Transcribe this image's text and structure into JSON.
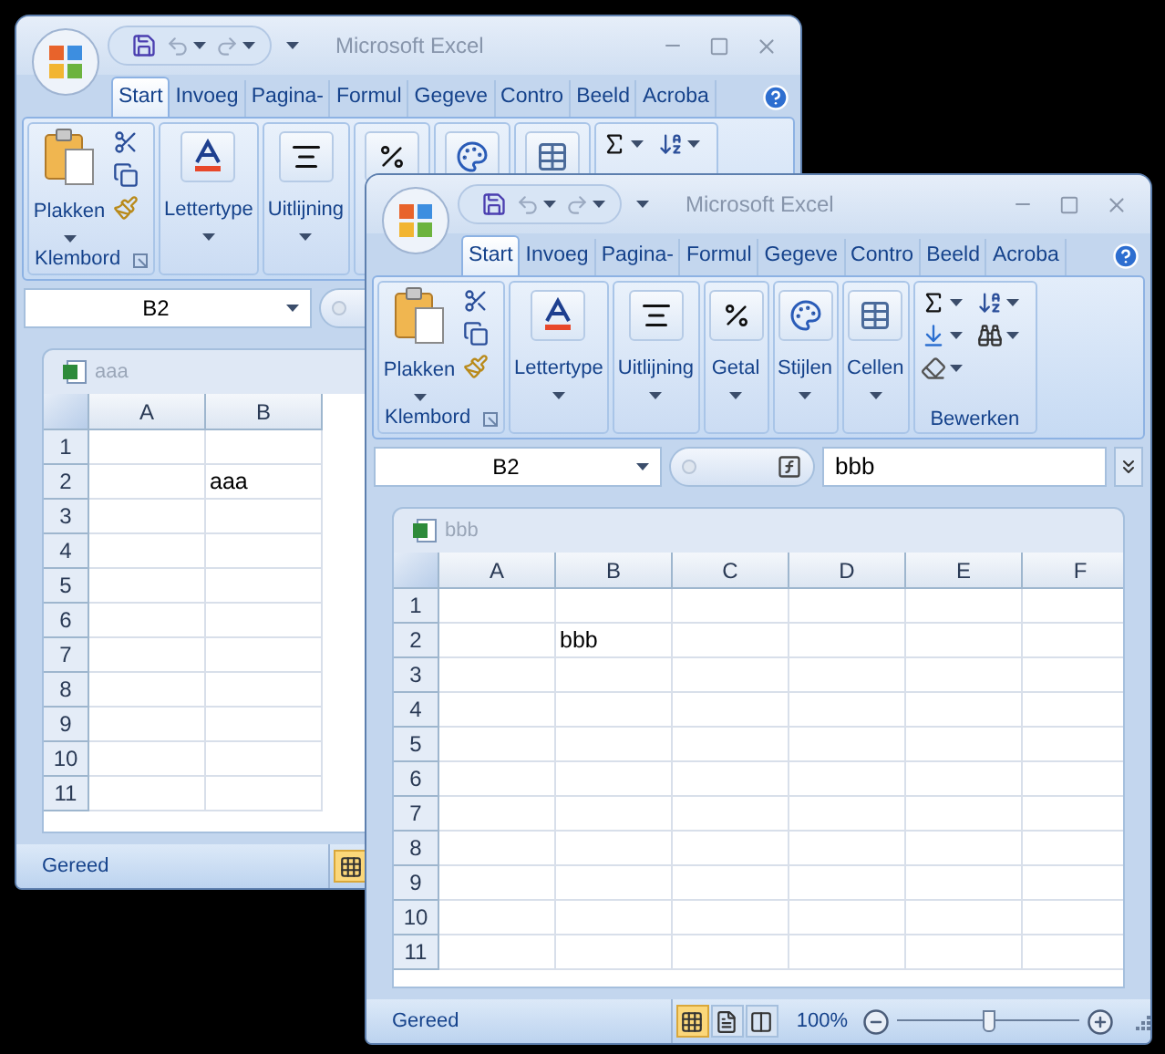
{
  "windows": [
    {
      "title": "Microsoft Excel",
      "tabs": [
        {
          "label": "Start",
          "selected": true
        },
        {
          "label": "Invoeg",
          "selected": false
        },
        {
          "label": "Pagina-",
          "selected": false
        },
        {
          "label": "Formul",
          "selected": false
        },
        {
          "label": "Gegeve",
          "selected": false
        },
        {
          "label": "Contro",
          "selected": false
        },
        {
          "label": "Beeld",
          "selected": false
        },
        {
          "label": "Acroba",
          "selected": false
        }
      ],
      "ribbon": [
        {
          "kind": "clipboard",
          "button": "Plakken",
          "label": "Klembord"
        },
        {
          "kind": "font",
          "button": "Lettertype"
        },
        {
          "kind": "alignment",
          "button": "Uitlijning"
        },
        {
          "kind": "number"
        },
        {
          "kind": "styles"
        },
        {
          "kind": "cells"
        },
        {
          "kind": "editing"
        }
      ],
      "formula_bar": {
        "name_box": "B2"
      },
      "document": {
        "title": "aaa",
        "columns": [
          "A",
          "B"
        ],
        "rows": [
          {
            "label": "1"
          },
          {
            "label": "2",
            "cells": [
              null,
              "aaa"
            ]
          },
          {
            "label": "3"
          },
          {
            "label": "4"
          },
          {
            "label": "5"
          },
          {
            "label": "6"
          },
          {
            "label": "7"
          },
          {
            "label": "8"
          },
          {
            "label": "9"
          },
          {
            "label": "10"
          },
          {
            "label": "11"
          }
        ]
      },
      "status_bar": {
        "text": "Gereed",
        "views": [
          {
            "kind": "normal",
            "selected": true
          }
        ]
      }
    },
    {
      "title": "Microsoft Excel",
      "tabs": [
        {
          "label": "Start",
          "selected": true
        },
        {
          "label": "Invoeg",
          "selected": false
        },
        {
          "label": "Pagina-",
          "selected": false
        },
        {
          "label": "Formul",
          "selected": false
        },
        {
          "label": "Gegeve",
          "selected": false
        },
        {
          "label": "Contro",
          "selected": false
        },
        {
          "label": "Beeld",
          "selected": false
        },
        {
          "label": "Acroba",
          "selected": false
        }
      ],
      "ribbon": [
        {
          "kind": "clipboard",
          "button": "Plakken",
          "label": "Klembord"
        },
        {
          "kind": "font",
          "button": "Lettertype"
        },
        {
          "kind": "alignment",
          "button": "Uitlijning"
        },
        {
          "kind": "number",
          "button": "Getal"
        },
        {
          "kind": "styles",
          "button": "Stijlen"
        },
        {
          "kind": "cells",
          "button": "Cellen"
        },
        {
          "kind": "editing",
          "label": "Bewerken"
        }
      ],
      "formula_bar": {
        "name_box": "B2",
        "value": "bbb"
      },
      "document": {
        "title": "bbb",
        "columns": [
          "A",
          "B",
          "C",
          "D",
          "E",
          "F"
        ],
        "rows": [
          {
            "label": "1"
          },
          {
            "label": "2",
            "cells": [
              null,
              "bbb"
            ]
          },
          {
            "label": "3"
          },
          {
            "label": "4"
          },
          {
            "label": "5"
          },
          {
            "label": "6"
          },
          {
            "label": "7"
          },
          {
            "label": "8"
          },
          {
            "label": "9"
          },
          {
            "label": "10"
          },
          {
            "label": "11"
          }
        ]
      },
      "status_bar": {
        "text": "Gereed",
        "views": [
          {
            "kind": "normal",
            "selected": true
          },
          {
            "kind": "layout",
            "selected": false
          },
          {
            "kind": "pagebreak",
            "selected": false
          }
        ],
        "zoom": {
          "reading": "100%",
          "level": 0.5
        }
      }
    }
  ]
}
